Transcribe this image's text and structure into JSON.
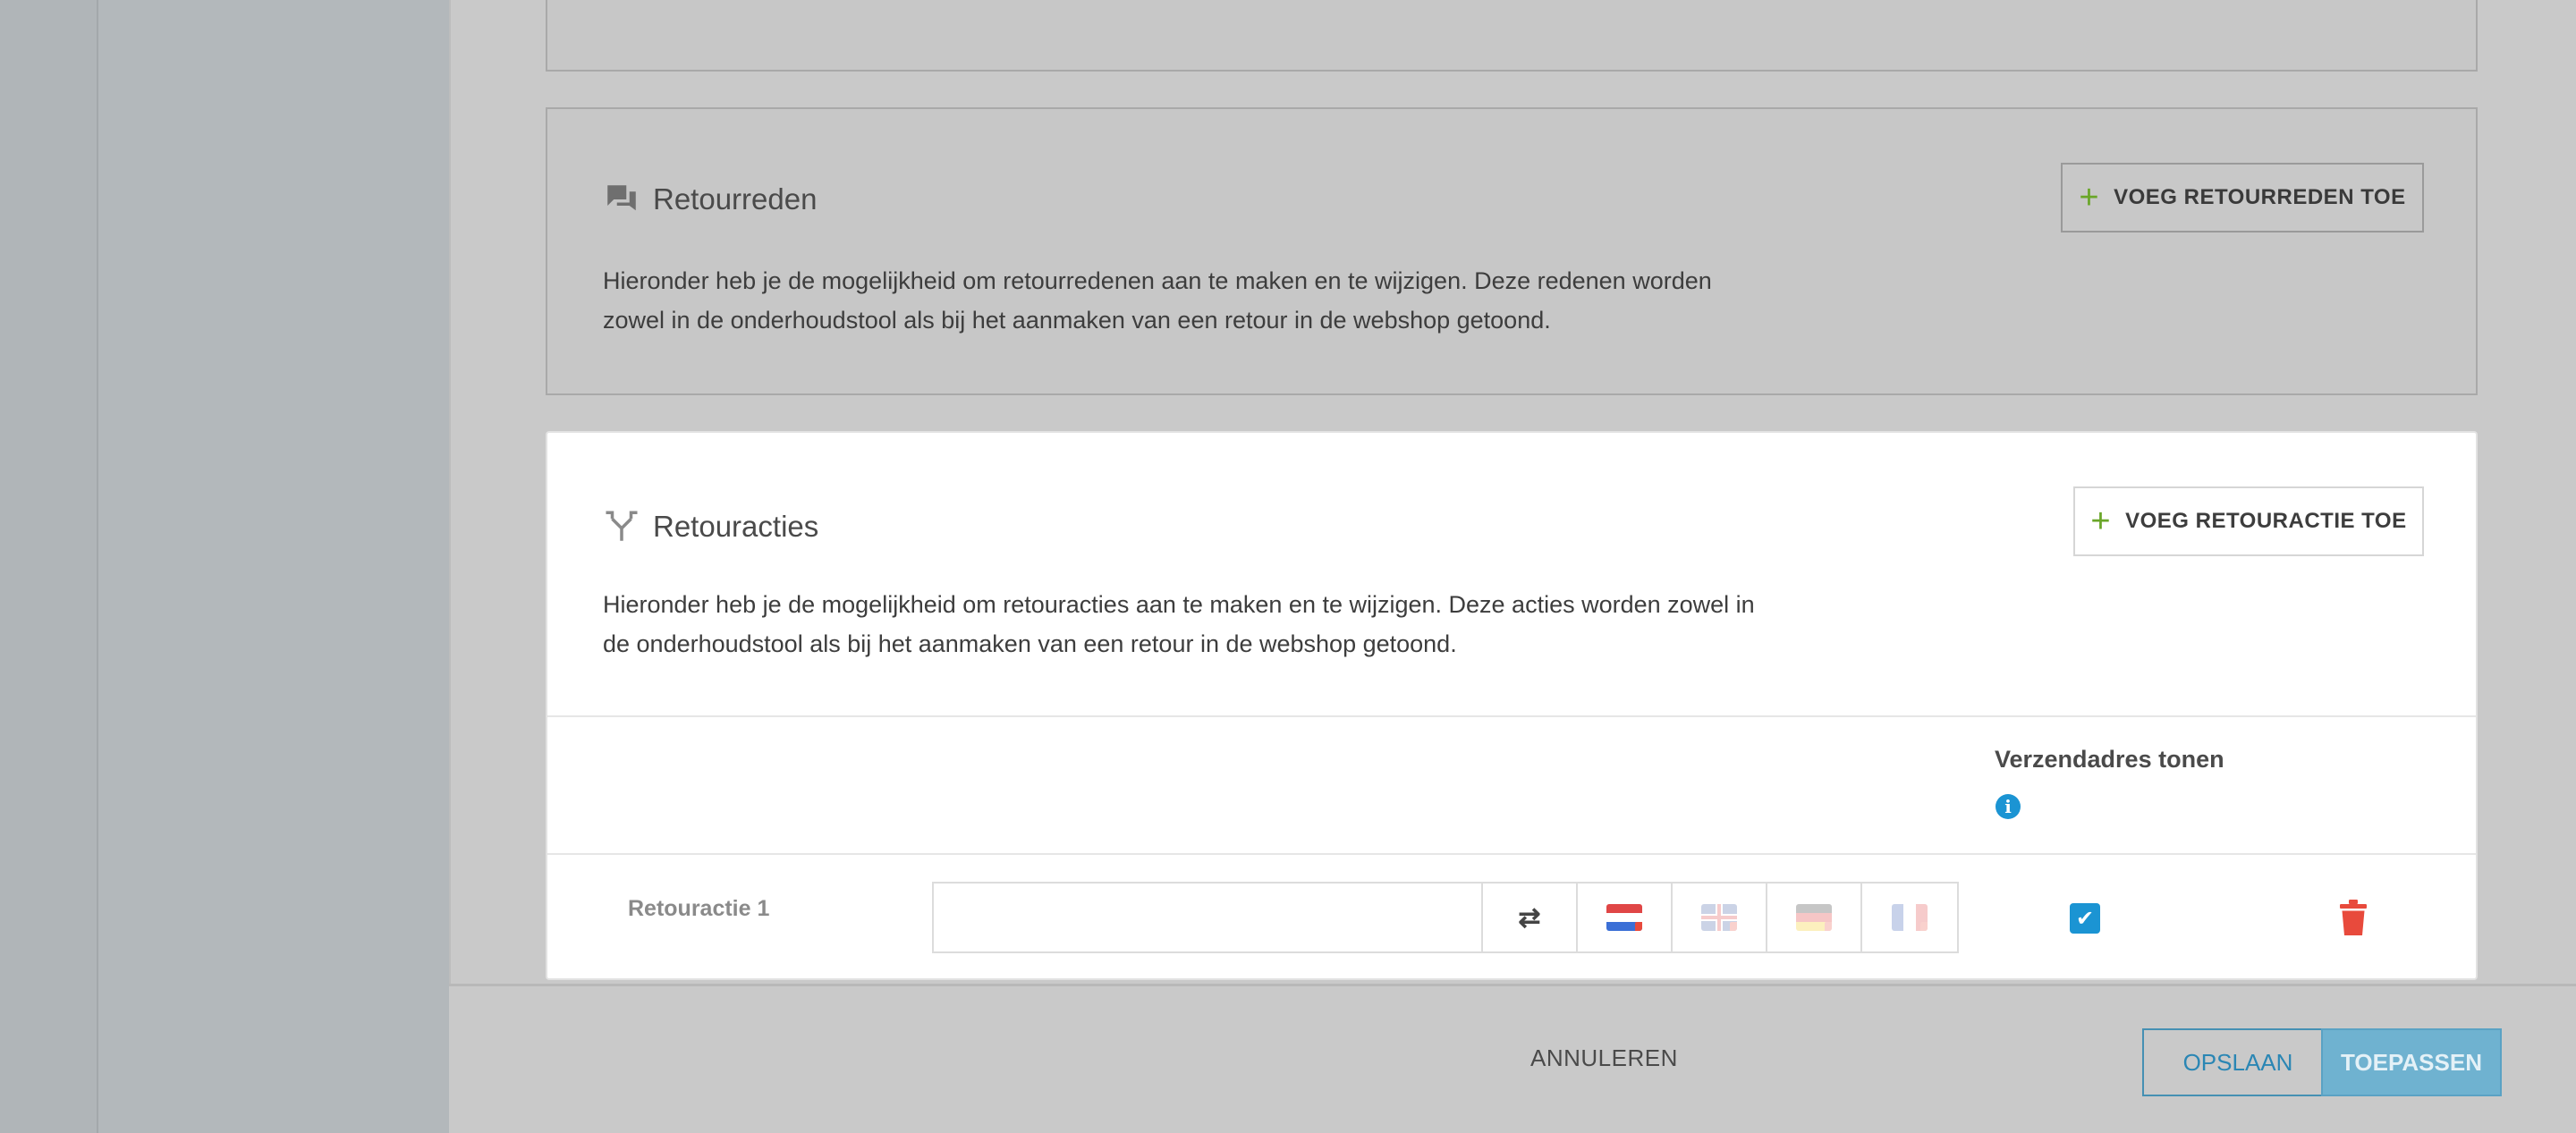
{
  "reasons": {
    "title": "Retourreden",
    "description_line1": "Hieronder heb je de mogelijkheid om retourredenen aan te maken en te wijzigen. Deze redenen worden",
    "description_line2": "zowel in de onderhoudstool als bij het aanmaken van een retour in de webshop getoond.",
    "add_button": "VOEG RETOURREDEN TOE",
    "icon": "chat-bubbles-icon"
  },
  "actions": {
    "title": "Retouracties",
    "description_line1": "Hieronder heb je de mogelijkheid om retouracties aan te maken en te wijzigen. Deze acties worden zowel in",
    "description_line2": "de onderhoudstool als bij het aanmaken van een retour in de webshop getoond.",
    "add_button": "VOEG RETOURACTIE TOE",
    "icon": "split-arrows-icon",
    "column_header": "Verzendadres tonen",
    "rows": [
      {
        "label": "Retouractie 1",
        "input_value": "",
        "show_shipping_address": true,
        "languages": [
          "nl",
          "en",
          "de",
          "fr"
        ]
      }
    ]
  },
  "footer": {
    "cancel": "ANNULEREN",
    "save": "OPSLAAN",
    "apply": "TOEPASSEN"
  },
  "colors": {
    "accent_blue": "#1b94d3",
    "plus_green": "#6aa629",
    "delete_red": "#e84a3c"
  }
}
